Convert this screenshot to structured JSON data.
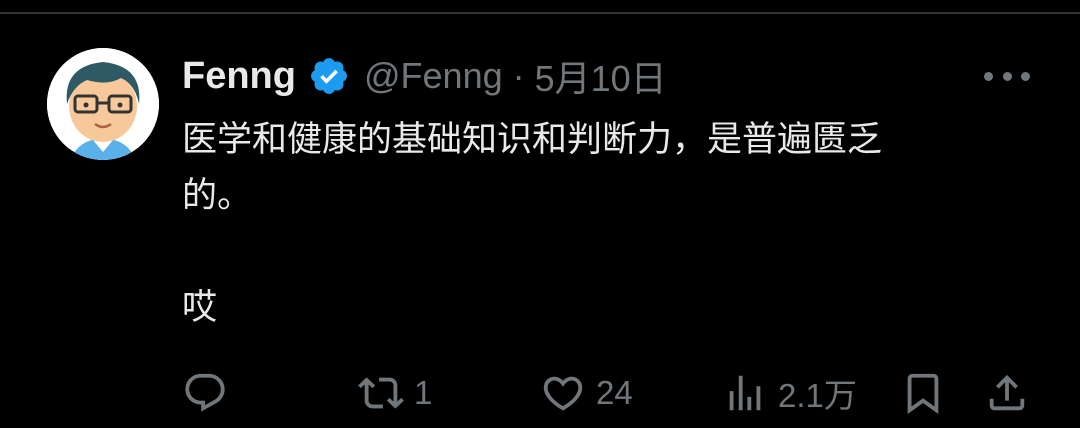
{
  "tweet": {
    "display_name": "Fenng",
    "handle": "@Fenng",
    "separator": "·",
    "date": "5月10日",
    "text_line1": "医学和健康的基础知识和判断力，是普遍匮乏",
    "text_line2": "的。",
    "text_line3": "哎"
  },
  "actions": {
    "reply_count": "",
    "retweet_count": "1",
    "like_count": "24",
    "view_count": "2.1万"
  },
  "colors": {
    "background": "#000000",
    "text": "#e7e9ea",
    "secondary": "#71767b",
    "verified": "#1d9bf0"
  },
  "icons": [
    "verified-badge-icon",
    "more-icon",
    "reply-icon",
    "retweet-icon",
    "like-icon",
    "views-icon",
    "bookmark-icon",
    "share-icon"
  ]
}
